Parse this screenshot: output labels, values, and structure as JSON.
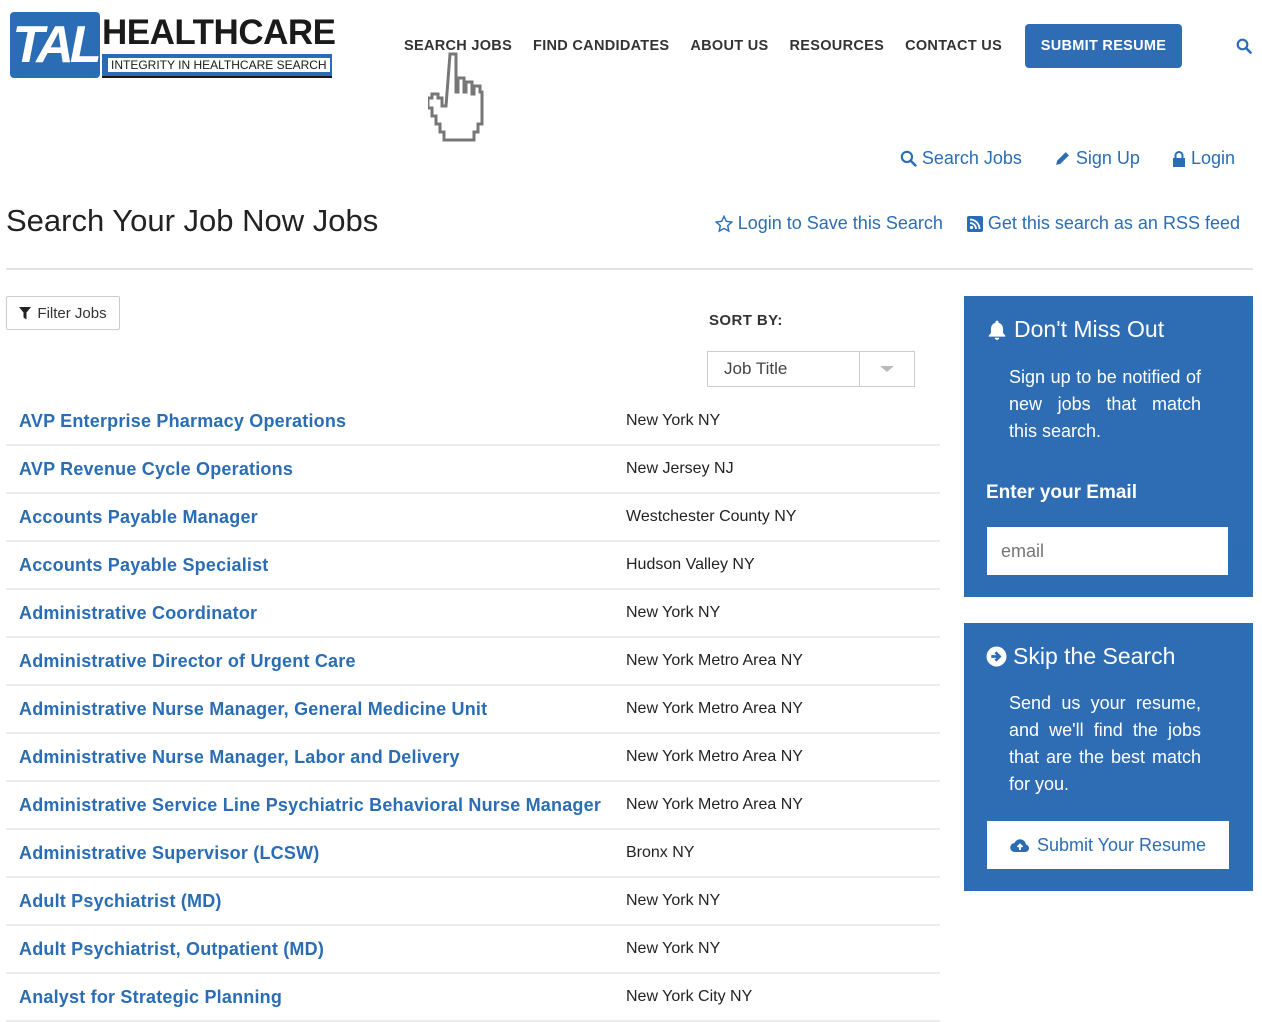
{
  "header": {
    "logo_mark": "TAL",
    "logo_name": "HEALTHCARE",
    "logo_tagline": "INTEGRITY IN HEALTHCARE SEARCH",
    "nav": [
      "SEARCH JOBS",
      "FIND CANDIDATES",
      "ABOUT US",
      "RESOURCES",
      "CONTACT US"
    ],
    "submit_resume": "SUBMIT RESUME",
    "accent_color": "#2e6db4"
  },
  "user_links": {
    "search_jobs": "Search Jobs",
    "sign_up": "Sign Up",
    "login": "Login"
  },
  "page": {
    "title": "Search Your Job Now Jobs",
    "save_search": "Login to Save this Search",
    "rss": "Get this search as an RSS feed"
  },
  "filters": {
    "filter_button": "Filter Jobs",
    "sort_label": "SORT BY:",
    "sort_value": "Job Title"
  },
  "jobs": [
    {
      "title": "AVP Enterprise Pharmacy Operations",
      "location": "New York NY"
    },
    {
      "title": "AVP Revenue Cycle Operations",
      "location": "New Jersey NJ"
    },
    {
      "title": "Accounts Payable Manager",
      "location": "Westchester County NY"
    },
    {
      "title": "Accounts Payable Specialist",
      "location": "Hudson Valley NY"
    },
    {
      "title": "Administrative Coordinator",
      "location": "New York NY"
    },
    {
      "title": "Administrative Director of Urgent Care",
      "location": "New York Metro Area NY"
    },
    {
      "title": "Administrative Nurse Manager, General Medicine Unit",
      "location": "New York Metro Area NY"
    },
    {
      "title": "Administrative Nurse Manager, Labor and Delivery",
      "location": "New York Metro Area NY"
    },
    {
      "title": "Administrative Service Line Psychiatric Behavioral Nurse Manager",
      "location": "New York Metro Area NY"
    },
    {
      "title": "Administrative Supervisor (LCSW)",
      "location": "Bronx NY"
    },
    {
      "title": "Adult Psychiatrist (MD)",
      "location": "New York NY"
    },
    {
      "title": "Adult Psychiatrist, Outpatient (MD)",
      "location": "New York NY"
    },
    {
      "title": "Analyst for Strategic Planning",
      "location": "New York City NY"
    }
  ],
  "sidebar": {
    "alert": {
      "title": "Don't Miss Out",
      "text": "Sign up to be notified of new jobs that match this search.",
      "email_label": "Enter your Email",
      "email_placeholder": "email"
    },
    "skip": {
      "title": "Skip the Search",
      "text": "Send us your resume, and we'll find the jobs that are the best match for you.",
      "button": "Submit Your Resume"
    }
  }
}
